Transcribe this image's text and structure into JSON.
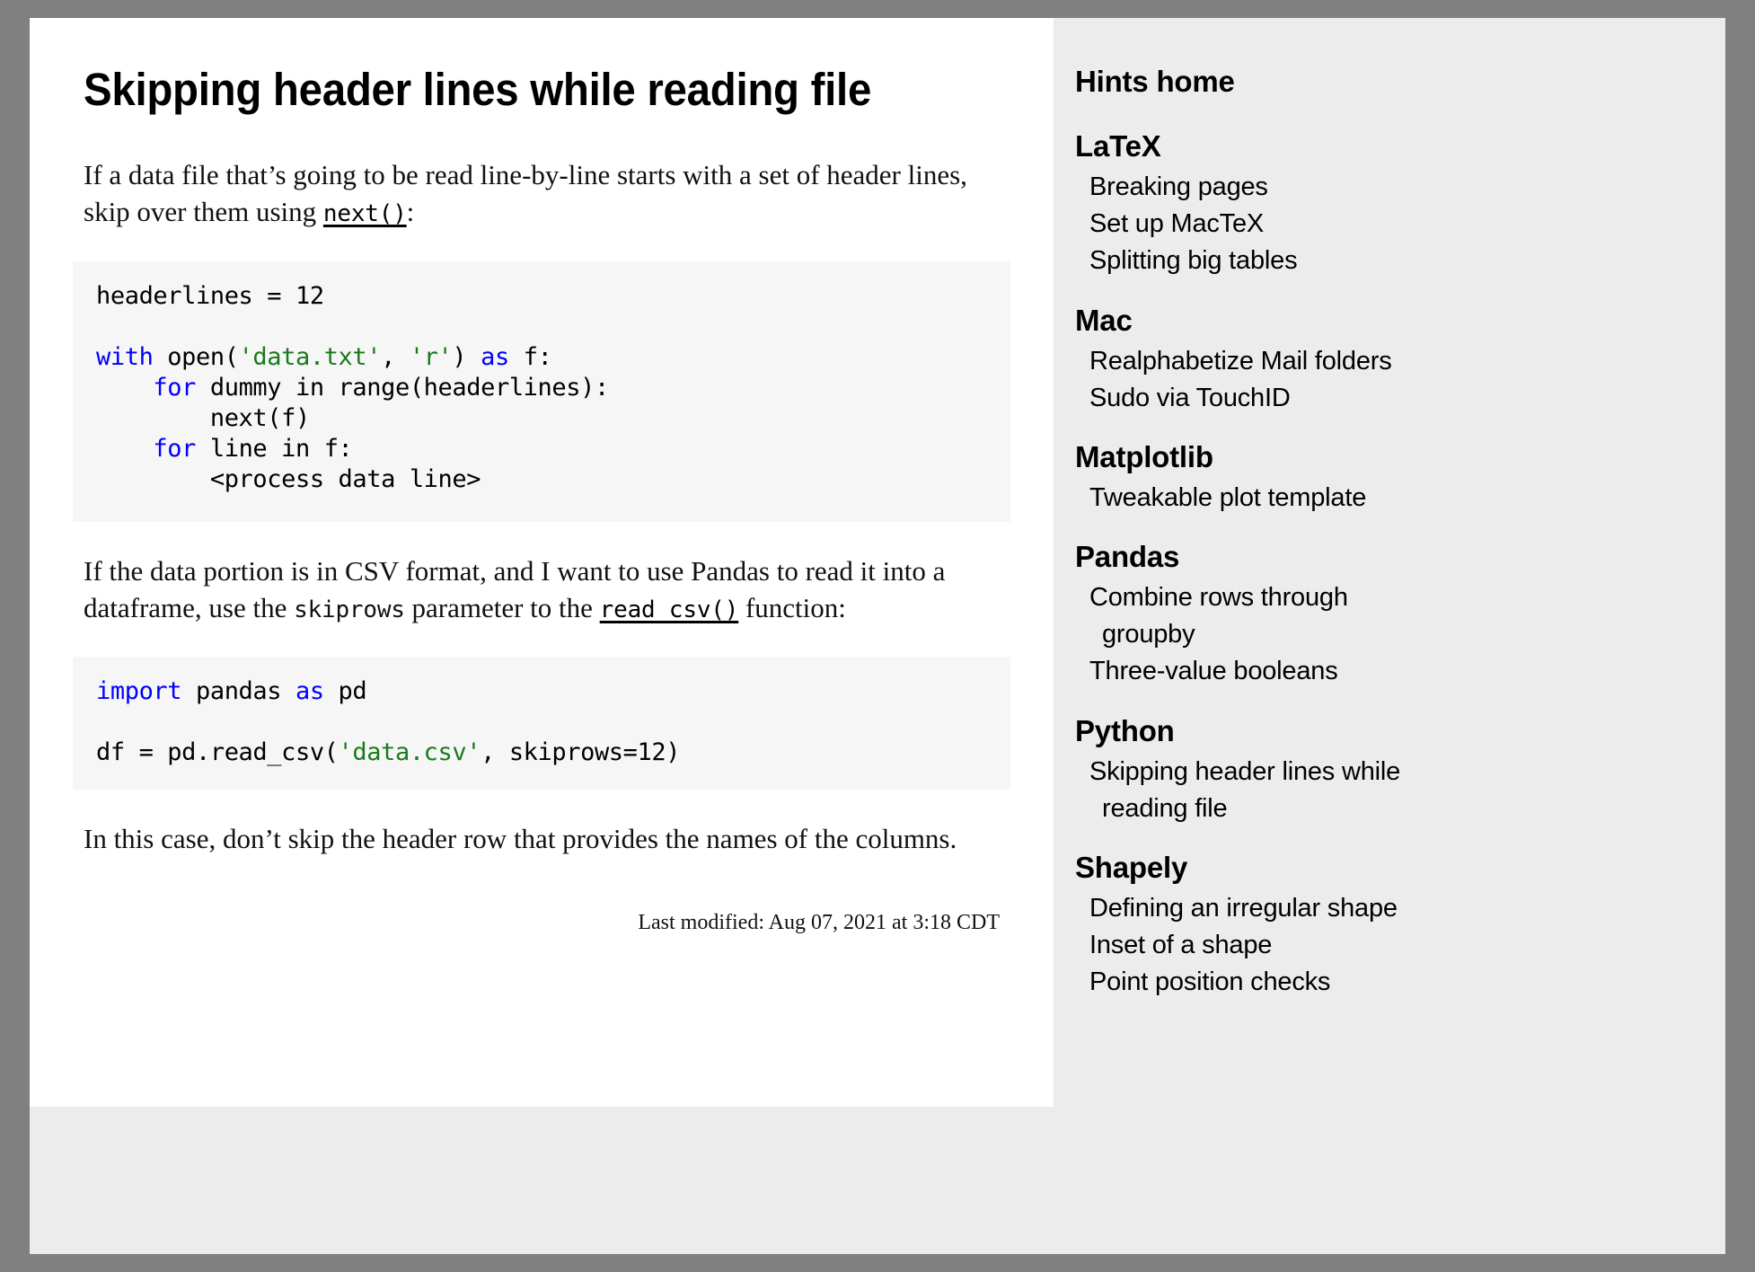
{
  "colors": {
    "page_background": "#808080",
    "content_background": "#ffffff",
    "sidebar_background": "#ececec",
    "code_background": "#f6f6f6",
    "keyword": "#0000ff",
    "string": "#1a7a1a",
    "text": "#111111"
  },
  "main": {
    "title": "Skipping header lines while reading file",
    "paragraph_1": {
      "before": "If a data file that’s going to be read line-by-line starts with a set of header lines, skip over them using ",
      "link": "next()",
      "after": ":"
    },
    "code_block_1": {
      "line_1_a": "headerlines = 12",
      "line_1_blank": "",
      "line_2_kw": "with",
      "line_2_a": " open(",
      "line_2_str_1": "'data.txt'",
      "line_2_b": ", ",
      "line_2_str_2": "'r'",
      "line_2_c": ") ",
      "line_2_kw_2": "as",
      "line_2_d": " f:",
      "line_3_indent": "    ",
      "line_3_kw": "for",
      "line_3_a": " dummy in range(headerlines):",
      "line_4": "        next(f)",
      "line_5_indent": "    ",
      "line_5_kw": "for",
      "line_5_a": " line in f:",
      "line_6": "        <process data line>"
    },
    "paragraph_2": {
      "part_1": "If the data portion is in CSV format, and I want to use Pandas to read it into a dataframe, use the ",
      "inline_code_1": "skiprows",
      "part_2": " parameter to the ",
      "link": "read_csv()",
      "part_3": " function:"
    },
    "code_block_2": {
      "line_1_kw": "import",
      "line_1_a": " pandas ",
      "line_1_kw_2": "as",
      "line_1_b": " pd",
      "line_2_blank": "",
      "line_3_a": "df = pd.read_csv(",
      "line_3_str": "'data.csv'",
      "line_3_b": ", skiprows=12)"
    },
    "paragraph_3": "In this case, don’t skip the header row that provides the names of the columns.",
    "last_modified": "Last modified: Aug 07, 2021 at 3:18 CDT"
  },
  "sidebar": {
    "home_label": "Hints home",
    "groups": [
      {
        "heading": "LaTeX",
        "items": [
          "Breaking pages",
          "Set up MacTeX",
          "Splitting big tables"
        ]
      },
      {
        "heading": "Mac",
        "items": [
          "Realphabetize Mail folders",
          "Sudo via TouchID"
        ]
      },
      {
        "heading": "Matplotlib",
        "items": [
          "Tweakable plot template"
        ]
      },
      {
        "heading": "Pandas",
        "items": [
          "Combine rows through groupby",
          "Three-value booleans"
        ]
      },
      {
        "heading": "Python",
        "items": [
          "Skipping header lines while reading file"
        ]
      },
      {
        "heading": "Shapely",
        "items": [
          "Defining an irregular shape",
          "Inset of a shape",
          "Point position checks"
        ]
      }
    ]
  }
}
